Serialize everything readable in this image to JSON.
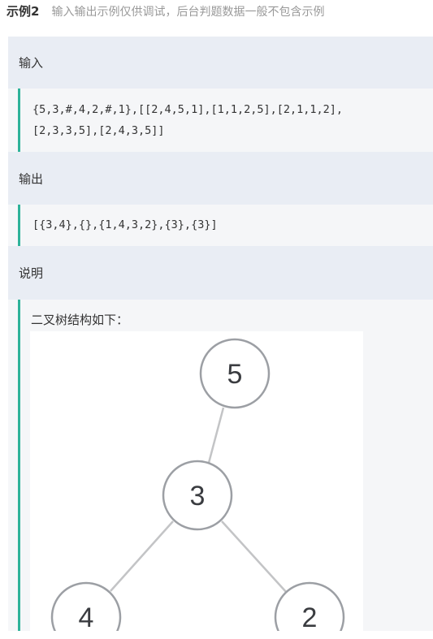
{
  "example": {
    "title": "示例2",
    "note": "输入输出示例仅供调试，后台判题数据一般不包含示例"
  },
  "input": {
    "label": "输入",
    "line1": "{5,3,#,4,2,#,1},[[2,4,5,1],[1,1,2,5],[2,1,1,2],",
    "line2": "[2,3,3,5],[2,4,3,5]]"
  },
  "output": {
    "label": "输出",
    "value": "[{3,4},{},{1,4,3,2},{3},{3}]"
  },
  "explanation": {
    "label": "说明",
    "caption": "二叉树结构如下：",
    "tree": {
      "node_root": "5",
      "node_mid": "3",
      "node_left": "4",
      "node_right": "2"
    }
  }
}
